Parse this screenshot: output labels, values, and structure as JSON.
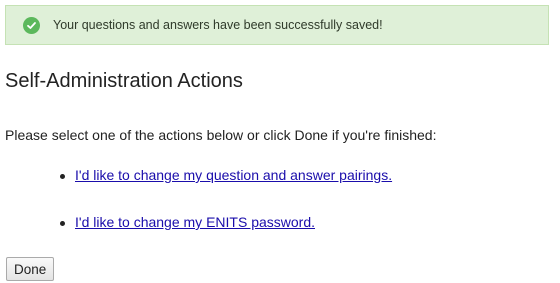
{
  "alert": {
    "icon": "check-circle-icon",
    "message": "Your questions and answers have been successfully saved!",
    "background": "#dff0d8",
    "icon_color": "#5cb85c"
  },
  "heading": "Self-Administration Actions",
  "instructions": "Please select one of the actions below or click Done if you're finished:",
  "actions": [
    {
      "label": "I'd like to change my question and answer pairings."
    },
    {
      "label": "I'd like to change my ENITS password."
    }
  ],
  "done_label": "Done",
  "link_color": "#1a0dab"
}
